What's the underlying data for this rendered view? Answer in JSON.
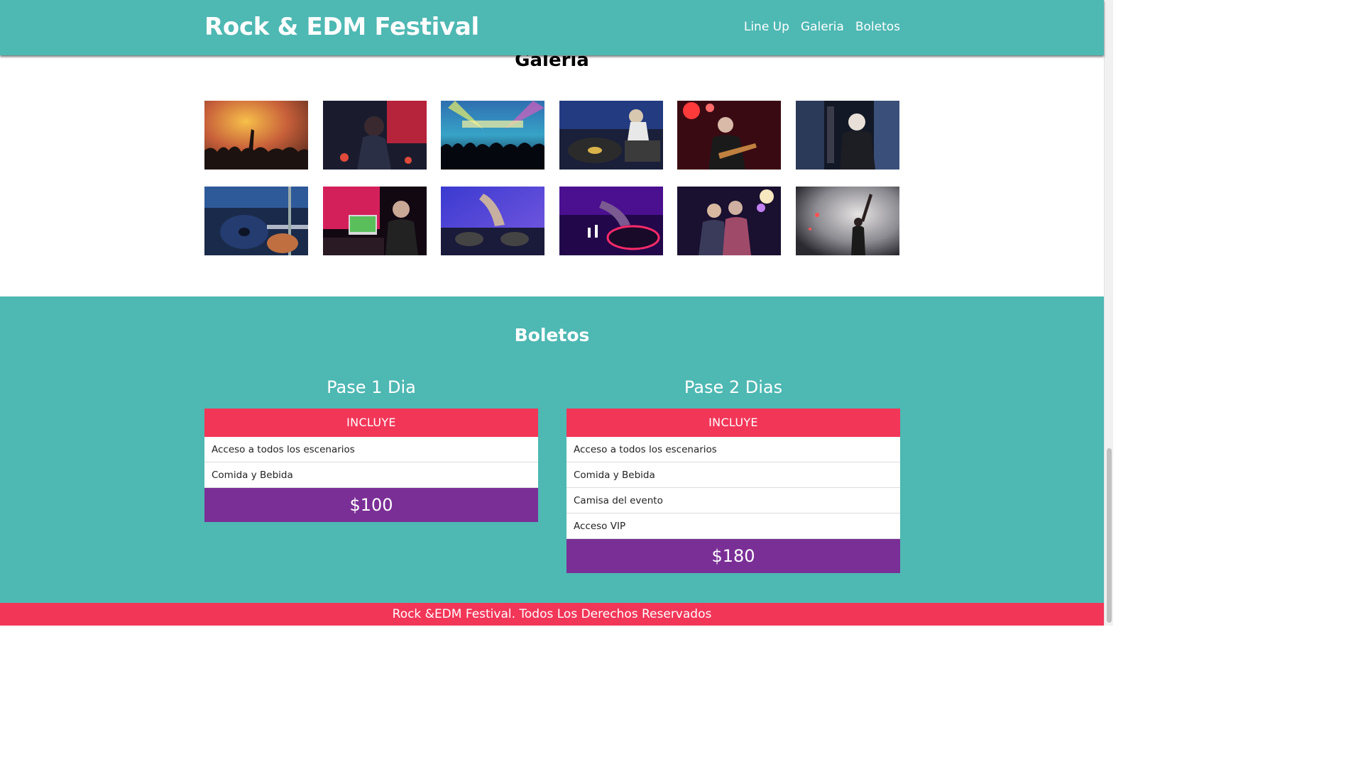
{
  "header": {
    "title": "Rock & EDM Festival",
    "nav": [
      "Line Up",
      "Galeria",
      "Boletos"
    ]
  },
  "gallery": {
    "title": "Galeria",
    "images": [
      "concert-crowd-image",
      "rock-singer-image",
      "edm-crowd-lights-image",
      "dj-turntables-image",
      "guitarist-red-stage-image",
      "dj-headphones-image",
      "guitar-player-closeup-image",
      "dj-laptop-pink-image",
      "dj-mixer-blue-image",
      "dj-mixer-purple-image",
      "band-duo-stage-image",
      "singer-smoke-image"
    ]
  },
  "tickets": {
    "title": "Boletos",
    "passes": [
      {
        "name": "Pase 1 Dia",
        "includes_label": "INCLUYE",
        "items": [
          "Acceso a todos los escenarios",
          "Comida y Bebida"
        ],
        "price": "$100"
      },
      {
        "name": "Pase 2 Dias",
        "includes_label": "INCLUYE",
        "items": [
          "Acceso a todos los escenarios",
          "Comida y Bebida",
          "Camisa del evento",
          "Acceso VIP"
        ],
        "price": "$180"
      }
    ]
  },
  "footer": {
    "text": "Rock &EDM Festival. Todos Los Derechos Reservados"
  },
  "colors": {
    "teal": "#4eb8b3",
    "pink": "#f23658",
    "purple": "#7a2f96"
  }
}
